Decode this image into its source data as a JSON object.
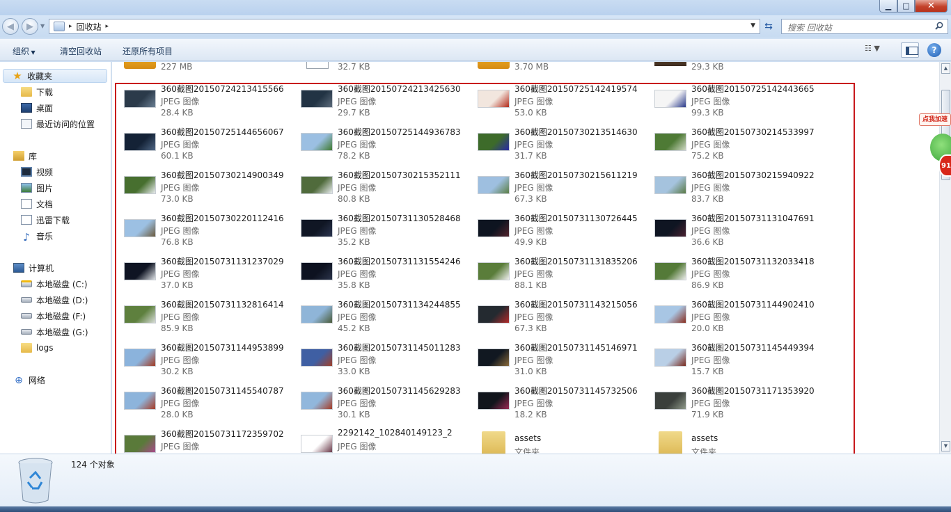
{
  "window": {
    "minimize": "▁",
    "maximize": "□",
    "close": "✕"
  },
  "address": {
    "location": "回收站",
    "arrow": "▸"
  },
  "search": {
    "placeholder": "搜索 回收站"
  },
  "toolbar": {
    "organize": "组织",
    "empty_bin": "清空回收站",
    "restore_all": "还原所有项目",
    "help": "?"
  },
  "sidebar": {
    "favorites": {
      "label": "收藏夹",
      "items": [
        "下载",
        "桌面",
        "最近访问的位置"
      ]
    },
    "libraries": {
      "label": "库",
      "items": [
        "视频",
        "图片",
        "文档",
        "迅雷下载",
        "音乐"
      ]
    },
    "computer": {
      "label": "计算机",
      "items": [
        "本地磁盘 (C:)",
        "本地磁盘 (D:)",
        "本地磁盘 (F:)",
        "本地磁盘 (G:)",
        "logs"
      ]
    },
    "network": {
      "label": "网络"
    }
  },
  "partial_row": {
    "sizes": [
      "227 MB",
      "32.7 KB",
      "3.70 MB",
      "29.3 KB"
    ]
  },
  "files": [
    {
      "name": "360截图20150724213415566",
      "type": "JPEG 图像",
      "size": "28.4 KB"
    },
    {
      "name": "360截图20150724213425630",
      "type": "JPEG 图像",
      "size": "29.7 KB"
    },
    {
      "name": "360截图20150725142419574",
      "type": "JPEG 图像",
      "size": "53.0 KB"
    },
    {
      "name": "360截图20150725142443665",
      "type": "JPEG 图像",
      "size": "99.3 KB"
    },
    {
      "name": "360截图20150725144656067",
      "type": "JPEG 图像",
      "size": "60.1 KB"
    },
    {
      "name": "360截图20150725144936783",
      "type": "JPEG 图像",
      "size": "78.2 KB"
    },
    {
      "name": "360截图20150730213514630",
      "type": "JPEG 图像",
      "size": "31.7 KB"
    },
    {
      "name": "360截图20150730214533997",
      "type": "JPEG 图像",
      "size": "75.2 KB"
    },
    {
      "name": "360截图20150730214900349",
      "type": "JPEG 图像",
      "size": "73.0 KB"
    },
    {
      "name": "360截图20150730215352111",
      "type": "JPEG 图像",
      "size": "80.8 KB"
    },
    {
      "name": "360截图20150730215611219",
      "type": "JPEG 图像",
      "size": "67.3 KB"
    },
    {
      "name": "360截图20150730215940922",
      "type": "JPEG 图像",
      "size": "83.7 KB"
    },
    {
      "name": "360截图20150730220112416",
      "type": "JPEG 图像",
      "size": "76.8 KB"
    },
    {
      "name": "360截图20150731130528468",
      "type": "JPEG 图像",
      "size": "35.2 KB"
    },
    {
      "name": "360截图20150731130726445",
      "type": "JPEG 图像",
      "size": "49.9 KB"
    },
    {
      "name": "360截图20150731131047691",
      "type": "JPEG 图像",
      "size": "36.6 KB"
    },
    {
      "name": "360截图20150731131237029",
      "type": "JPEG 图像",
      "size": "37.0 KB"
    },
    {
      "name": "360截图20150731131554246",
      "type": "JPEG 图像",
      "size": "35.8 KB"
    },
    {
      "name": "360截图20150731131835206",
      "type": "JPEG 图像",
      "size": "88.1 KB"
    },
    {
      "name": "360截图20150731132033418",
      "type": "JPEG 图像",
      "size": "86.9 KB"
    },
    {
      "name": "360截图20150731132816414",
      "type": "JPEG 图像",
      "size": "85.9 KB"
    },
    {
      "name": "360截图20150731134244855",
      "type": "JPEG 图像",
      "size": "45.2 KB"
    },
    {
      "name": "360截图20150731143215056",
      "type": "JPEG 图像",
      "size": "67.3 KB"
    },
    {
      "name": "360截图20150731144902410",
      "type": "JPEG 图像",
      "size": "20.0 KB"
    },
    {
      "name": "360截图20150731144953899",
      "type": "JPEG 图像",
      "size": "30.2 KB"
    },
    {
      "name": "360截图20150731145011283",
      "type": "JPEG 图像",
      "size": "33.0 KB"
    },
    {
      "name": "360截图20150731145146971",
      "type": "JPEG 图像",
      "size": "31.0 KB"
    },
    {
      "name": "360截图20150731145449394",
      "type": "JPEG 图像",
      "size": "15.7 KB"
    },
    {
      "name": "360截图20150731145540787",
      "type": "JPEG 图像",
      "size": "28.0 KB"
    },
    {
      "name": "360截图20150731145629283",
      "type": "JPEG 图像",
      "size": "30.1 KB"
    },
    {
      "name": "360截图20150731145732506",
      "type": "JPEG 图像",
      "size": "18.2 KB"
    },
    {
      "name": "360截图20150731171353920",
      "type": "JPEG 图像",
      "size": "71.9 KB"
    },
    {
      "name": "360截图20150731172359702",
      "type": "JPEG 图像",
      "size": ""
    },
    {
      "name": "2292142_102840149123_2",
      "type": "JPEG 图像",
      "size": ""
    },
    {
      "name": "assets",
      "type": "文件夹",
      "size": ""
    },
    {
      "name": "assets",
      "type": "文件夹",
      "size": ""
    }
  ],
  "thumb_colors": [
    [
      "#2b3a4a",
      "#6b7f93"
    ],
    [
      "#223344",
      "#5d6c7c"
    ],
    [
      "#f2e6de",
      "#b22a1a"
    ],
    [
      "#f5f5f5",
      "#2a3a8a"
    ],
    [
      "#142236",
      "#4f6785"
    ],
    [
      "#9bbfe2",
      "#3f7a2f"
    ],
    [
      "#3d6b2a",
      "#2a2aa5"
    ],
    [
      "#4e7a35",
      "#cfd8c4"
    ],
    [
      "#476f2f",
      "#e9ecef"
    ],
    [
      "#506b3c",
      "#e8ecef"
    ],
    [
      "#9ebfe0",
      "#5b7e44"
    ],
    [
      "#a5c3de",
      "#5a7a45"
    ],
    [
      "#9cc0e3",
      "#6b5a3c"
    ],
    [
      "#101624",
      "#2b3550"
    ],
    [
      "#0e1420",
      "#53232c"
    ],
    [
      "#0f1522",
      "#4a2130"
    ],
    [
      "#0f1423",
      "#dfe3e7"
    ],
    [
      "#0d1220",
      "#2a334a"
    ],
    [
      "#5a7d3a",
      "#efefef"
    ],
    [
      "#547a38",
      "#ececec"
    ],
    [
      "#5e803e",
      "#d8dcd8"
    ],
    [
      "#8fb5d8",
      "#4b5c3a"
    ],
    [
      "#242a30",
      "#b32a2a"
    ],
    [
      "#a8c6e4",
      "#8a2e1f"
    ],
    [
      "#8bb3dc",
      "#a33a22"
    ],
    [
      "#3f5fa3",
      "#a0402a"
    ],
    [
      "#111821",
      "#8a6a3a"
    ],
    [
      "#b9cfe6",
      "#7a2a1e"
    ],
    [
      "#8db4db",
      "#a83a24"
    ],
    [
      "#91b7dc",
      "#a53b25"
    ],
    [
      "#11151c",
      "#9a2a55"
    ],
    [
      "#3a3f3c",
      "#8f9a8a"
    ],
    [
      "#5a7a3a",
      "#a84a8a"
    ],
    [
      "#ffffff",
      "#6a3a4a"
    ],
    [
      "#f0d98a",
      "#d9b24a"
    ],
    [
      "#f0d98a",
      "#d9b24a"
    ]
  ],
  "selection_highlight": "#c8171b",
  "accelerator": {
    "badge": "点我加速",
    "count": "91"
  },
  "status": {
    "count": "124 个对象"
  }
}
